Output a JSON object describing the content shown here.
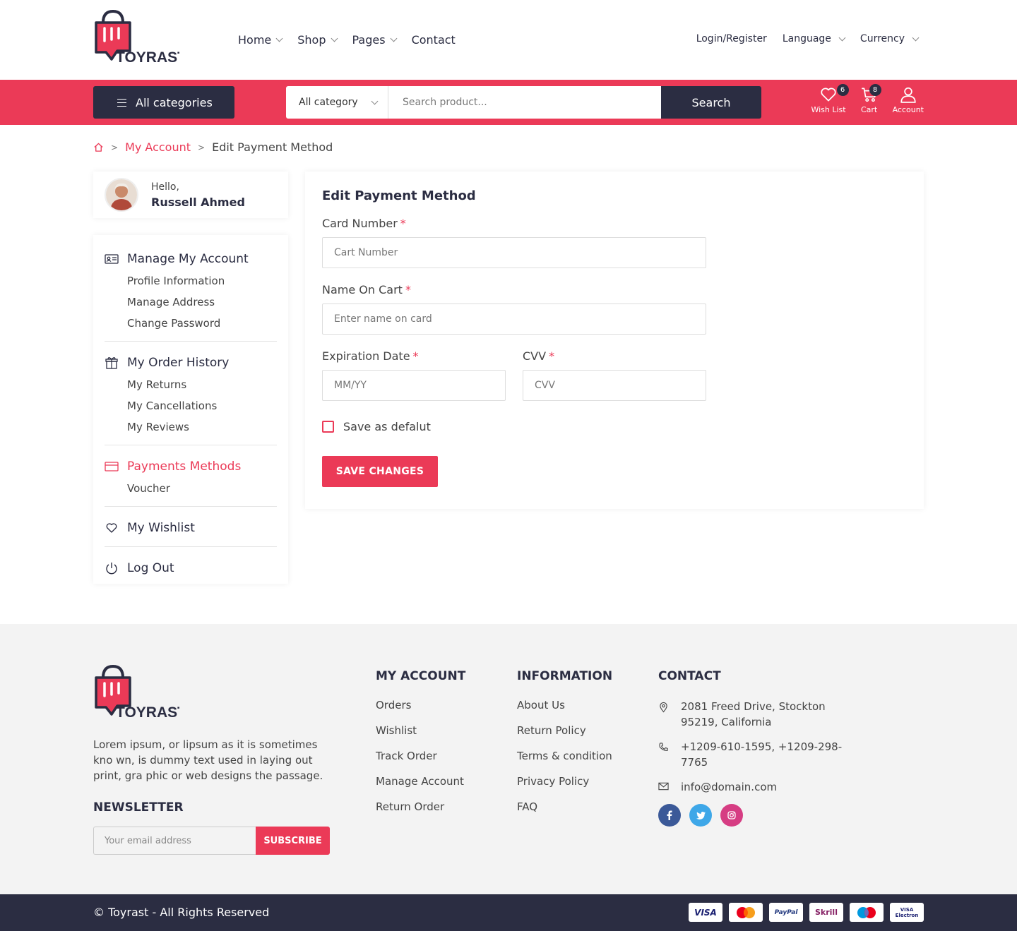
{
  "brand": {
    "name": "TOYRAST",
    "accent": "#eb3a57",
    "dark": "#2b2d42"
  },
  "nav": {
    "items": [
      "Home",
      "Shop",
      "Pages",
      "Contact"
    ],
    "login": "Login/Register",
    "language": "Language",
    "currency": "Currency"
  },
  "search_bar": {
    "all_categories": "All categories",
    "category_select": "All category",
    "placeholder": "Search product...",
    "search_button": "Search",
    "wishlist_label": "Wish List",
    "wishlist_count": "6",
    "cart_label": "Cart",
    "cart_count": "8",
    "account_label": "Account"
  },
  "breadcrumb": {
    "link": "My Account",
    "current": "Edit Payment Method"
  },
  "profile": {
    "greeting": "Hello,",
    "name": "Russell Ahmed"
  },
  "sidebar": {
    "manage_account": "Manage My Account",
    "profile_info": "Profile Information",
    "manage_address": "Manage Address",
    "change_password": "Change Password",
    "order_history": "My Order History",
    "returns": "My Returns",
    "cancellations": "My Cancellations",
    "reviews": "My Reviews",
    "payments": "Payments Methods",
    "voucher": "Voucher",
    "wishlist": "My Wishlist",
    "logout": "Log Out"
  },
  "form": {
    "title": "Edit Payment Method",
    "card_number_label": "Card Number",
    "card_number_placeholder": "Cart Number",
    "name_label": "Name On Cart",
    "name_placeholder": "Enter name on card",
    "expiry_label": "Expiration Date",
    "expiry_placeholder": "MM/YY",
    "cvv_label": "CVV",
    "cvv_placeholder": "CVV",
    "required_mark": "*",
    "save_default": "Save as defalut",
    "save_button": "SAVE CHANGES"
  },
  "footer": {
    "description": "Lorem ipsum, or lipsum as it is sometimes kno wn, is dummy text used in laying out print, gra phic or web designs the passage.",
    "newsletter_title": "NEWSLETTER",
    "newsletter_placeholder": "Your email address",
    "subscribe": "SUBSCRIBE",
    "my_account_title": "MY ACCOUNT",
    "my_account_links": [
      "Orders",
      "Wishlist",
      "Track Order",
      "Manage Account",
      "Return Order"
    ],
    "information_title": "INFORMATION",
    "information_links": [
      "About Us",
      "Return Policy",
      "Terms & condition",
      "Privacy Policy",
      "FAQ"
    ],
    "contact_title": "CONTACT",
    "address": "2081 Freed Drive, Stockton 95219, California",
    "phone": "+1209-610-1595, +1209-298-7765",
    "email": "info@domain.com",
    "copyright": "© Toyrast - All Rights Reserved",
    "payment_cards": [
      "VISA",
      "MasterCard",
      "PayPal",
      "Skrill",
      "Maestro",
      "VISA Electron"
    ]
  }
}
